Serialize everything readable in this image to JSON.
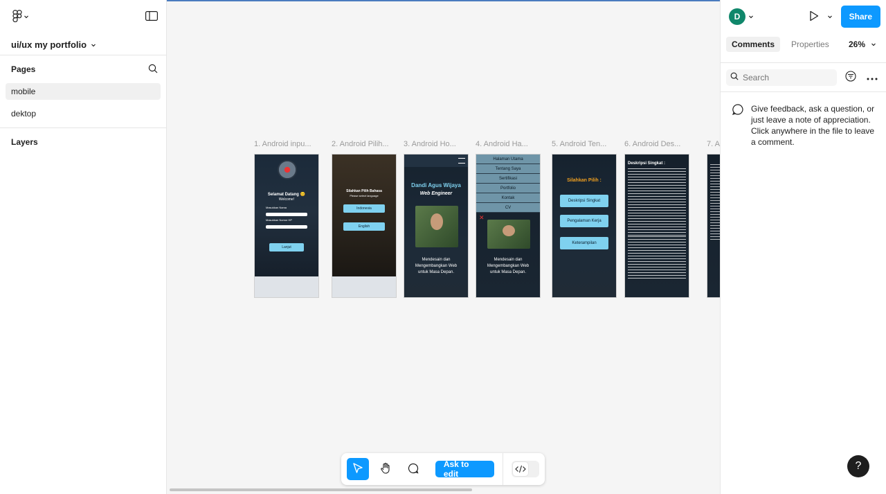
{
  "left_panel": {
    "file_title": "ui/ux my portfolio",
    "pages_heading": "Pages",
    "pages": [
      {
        "label": "mobile",
        "active": true
      },
      {
        "label": "dektop",
        "active": false
      }
    ],
    "layers_heading": "Layers"
  },
  "canvas": {
    "frames": [
      {
        "label": "1. Android inpu..."
      },
      {
        "label": "2. Android Pilih..."
      },
      {
        "label": "3. Android Ho..."
      },
      {
        "label": "4. Android Ha..."
      },
      {
        "label": "5. Android Ten..."
      },
      {
        "label": "6. Android Des..."
      },
      {
        "label": "7. A"
      }
    ],
    "frame1": {
      "welcome": "Selamat Datang 😊",
      "sub": "Welcome!",
      "field1": "Masukkan Nama",
      "field2": "Masukkan Nomor HP",
      "btn": "Lanjut"
    },
    "frame2": {
      "title": "Silahkan Pilih Bahasa",
      "sub": "Please select language",
      "opt1": "Indonesia",
      "opt2": "English"
    },
    "frame3": {
      "name": "Dandi Agus Wijaya",
      "role": "Web Engineer",
      "tag1": "Mendesain dan",
      "tag2": "Mengembangkan Web",
      "tag3": "untuk Masa Depan."
    },
    "frame4": {
      "menu": [
        "Halaman Utama",
        "Tentang Saya",
        "Sertifikasi",
        "Portfolio",
        "Kontak",
        "CV"
      ],
      "tag1": "Mendesain dan",
      "tag2": "Mengembangkan Web",
      "tag3": "untuk Masa Depan."
    },
    "frame5": {
      "title": "Silahkan Pilih :",
      "opt1": "Deskripsi Singkat",
      "opt2": "Pengalaman Kerja",
      "opt3": "Keterampilan"
    },
    "frame6": {
      "title": "Deskripsi Singkat :"
    }
  },
  "toolbar": {
    "ask_label": "Ask to edit"
  },
  "right_panel": {
    "avatar_initial": "D",
    "share_label": "Share",
    "tabs": [
      {
        "label": "Comments",
        "active": true
      },
      {
        "label": "Properties",
        "active": false
      }
    ],
    "zoom": "26%",
    "search_placeholder": "Search",
    "empty_message": "Give feedback, ask a question, or just leave a note of appreciation. Click anywhere in the file to leave a comment."
  },
  "help_label": "?",
  "colors": {
    "accent": "#0d99ff",
    "avatar": "#10876b",
    "button_light": "#7fd1ef"
  }
}
